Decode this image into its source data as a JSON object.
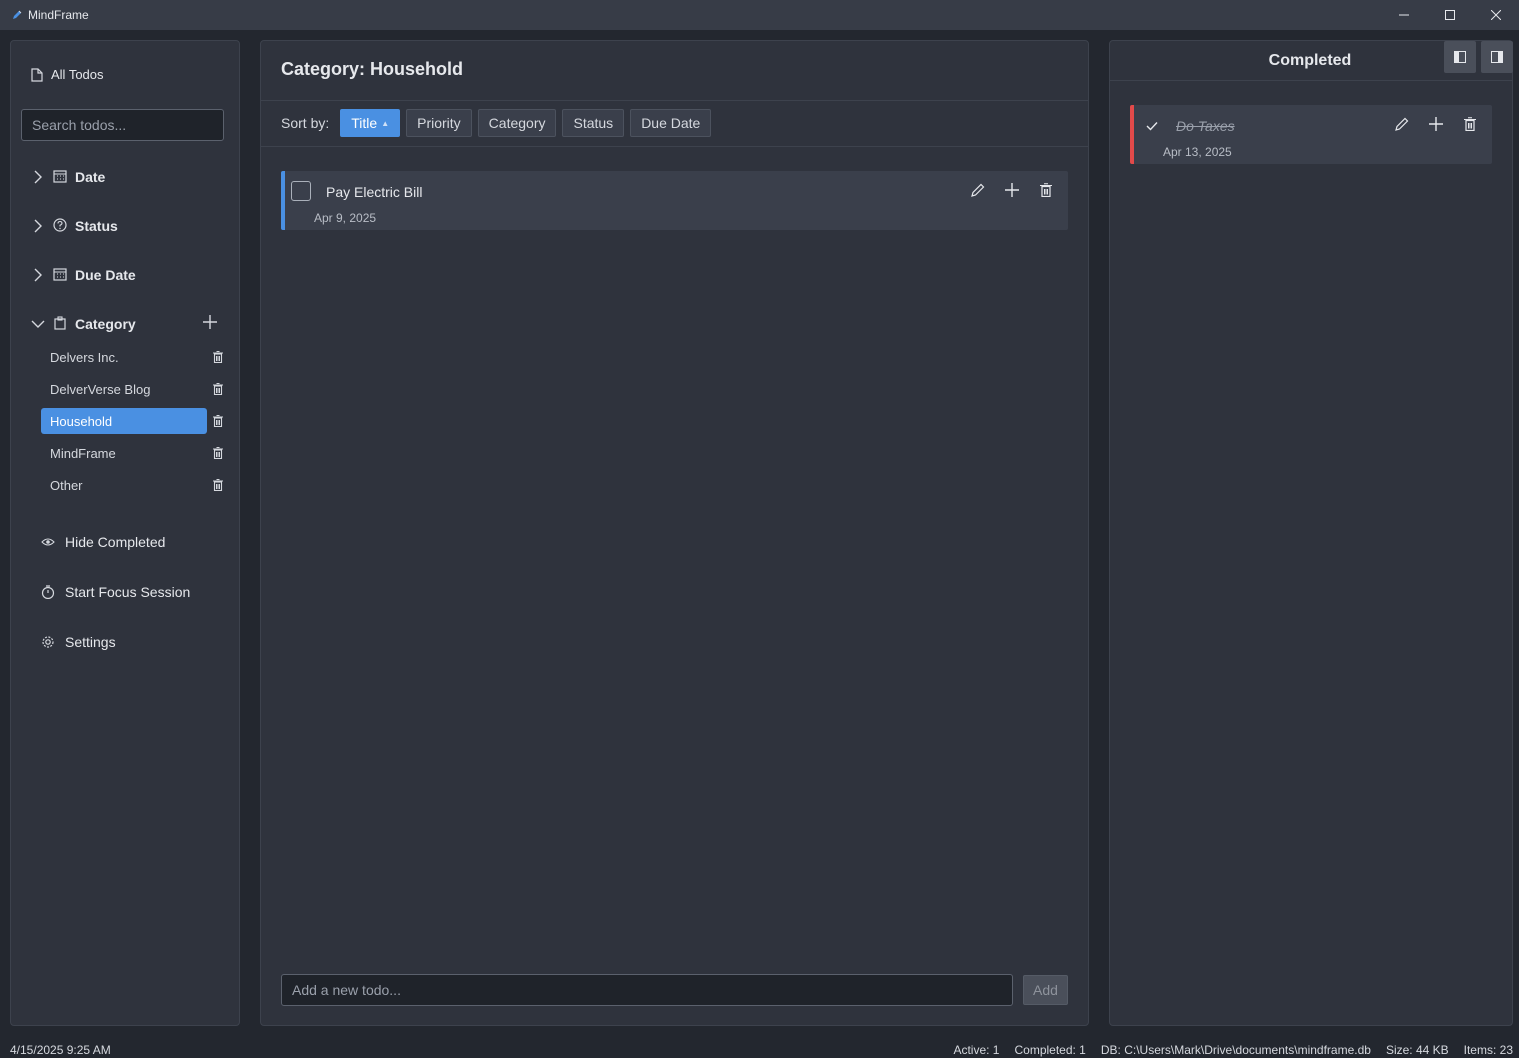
{
  "window": {
    "title": "MindFrame"
  },
  "sidebar": {
    "all_todos": "All Todos",
    "search_placeholder": "Search todos...",
    "sections": {
      "date": "Date",
      "status": "Status",
      "due_date": "Due Date",
      "category": "Category"
    },
    "categories": [
      {
        "label": "Delvers Inc."
      },
      {
        "label": "DelverVerse Blog"
      },
      {
        "label": "Household",
        "selected": true
      },
      {
        "label": "MindFrame"
      },
      {
        "label": "Other"
      }
    ],
    "actions": {
      "hide_completed": "Hide Completed",
      "focus_session": "Start Focus Session",
      "settings": "Settings"
    }
  },
  "main": {
    "title": "Category: Household",
    "sort_label": "Sort by:",
    "sort_buttons": [
      {
        "label": "Title",
        "active": true,
        "indicator": "▲"
      },
      {
        "label": "Priority"
      },
      {
        "label": "Category"
      },
      {
        "label": "Status"
      },
      {
        "label": "Due Date"
      }
    ],
    "todos": [
      {
        "title": "Pay Electric Bill",
        "date": "Apr 9, 2025",
        "done": false,
        "accent": "#4a90e2"
      }
    ],
    "add_placeholder": "Add a new todo...",
    "add_label": "Add"
  },
  "completed": {
    "title": "Completed",
    "todos": [
      {
        "title": "Do Taxes",
        "date": "Apr 13, 2025",
        "done": true,
        "accent": "#e24a4a"
      }
    ]
  },
  "statusbar": {
    "datetime": "4/15/2025 9:25 AM",
    "active": "Active: 1",
    "completed": "Completed: 1",
    "db": "DB: C:\\Users\\Mark\\Drive\\documents\\mindframe.db",
    "size": "Size: 44 KB",
    "items": "Items: 23"
  },
  "colors": {
    "accent": "#4a90e2",
    "danger": "#e24a4a",
    "background": "#23272f",
    "panel": "#2f333d"
  }
}
